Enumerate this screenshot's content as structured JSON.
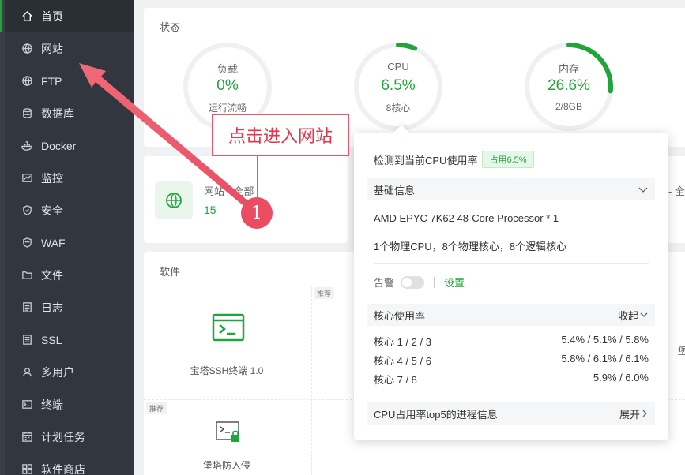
{
  "sidebar": {
    "items": [
      {
        "label": "首页",
        "icon": "home-icon",
        "active": true
      },
      {
        "label": "网站",
        "icon": "globe-icon"
      },
      {
        "label": "FTP",
        "icon": "ftp-icon"
      },
      {
        "label": "数据库",
        "icon": "database-icon"
      },
      {
        "label": "Docker",
        "icon": "docker-icon"
      },
      {
        "label": "监控",
        "icon": "monitor-icon"
      },
      {
        "label": "安全",
        "icon": "shield-icon"
      },
      {
        "label": "WAF",
        "icon": "waf-icon"
      },
      {
        "label": "文件",
        "icon": "folder-icon"
      },
      {
        "label": "日志",
        "icon": "log-icon"
      },
      {
        "label": "SSL",
        "icon": "ssl-icon"
      },
      {
        "label": "多用户",
        "icon": "users-icon"
      },
      {
        "label": "终端",
        "icon": "terminal-icon"
      },
      {
        "label": "计划任务",
        "icon": "schedule-icon"
      },
      {
        "label": "软件商店",
        "icon": "store-icon"
      }
    ]
  },
  "status": {
    "title": "状态",
    "gauges": [
      {
        "label": "负载",
        "value": "0%",
        "sub": "运行流畅",
        "percent": 0
      },
      {
        "label": "CPU",
        "value": "6.5%",
        "sub": "8核心",
        "percent": 6.5
      },
      {
        "label": "内存",
        "value": "26.6%",
        "sub": "2/8GB",
        "percent": 26.6
      }
    ]
  },
  "site_card": {
    "name": "网站 - 全部",
    "count": "15"
  },
  "right_partial": "- 全",
  "software": {
    "title": "软件",
    "recommend_badge": "推荐",
    "items": [
      {
        "name": "宝塔SSH终端 1.0",
        "icon": "terminal-app-icon"
      },
      {
        "name": "堡塔防入侵",
        "icon": "intrusion-guard-icon"
      }
    ],
    "right_partial": "堡"
  },
  "popover": {
    "heading": "检测到当前CPU使用率",
    "usage_badge": "占用6.5%",
    "basic_info_title": "基础信息",
    "processor": "AMD EPYC 7K62 48-Core Processor * 1",
    "cores_desc": "1个物理CPU，8个物理核心，8个逻辑核心",
    "alarm_label": "告警",
    "alarm_settings": "设置",
    "core_usage_title": "核心使用率",
    "collapse_label": "收起",
    "cores": [
      {
        "name": "核心 1 / 2 / 3",
        "value": "5.4% / 5.1% / 5.8%"
      },
      {
        "name": "核心 4 / 5 / 6",
        "value": "5.8% / 6.1% / 6.1%"
      },
      {
        "name": "核心 7 / 8",
        "value": "5.9% / 6.0%"
      }
    ],
    "top5_title": "CPU占用率top5的进程信息",
    "expand_label": "展开"
  },
  "annotation": {
    "callout_text": "点击进入网站",
    "step_number": "1"
  },
  "colors": {
    "accent": "#20a53a",
    "annotation": "#ec4c62",
    "sidebar_bg": "#32373f"
  }
}
